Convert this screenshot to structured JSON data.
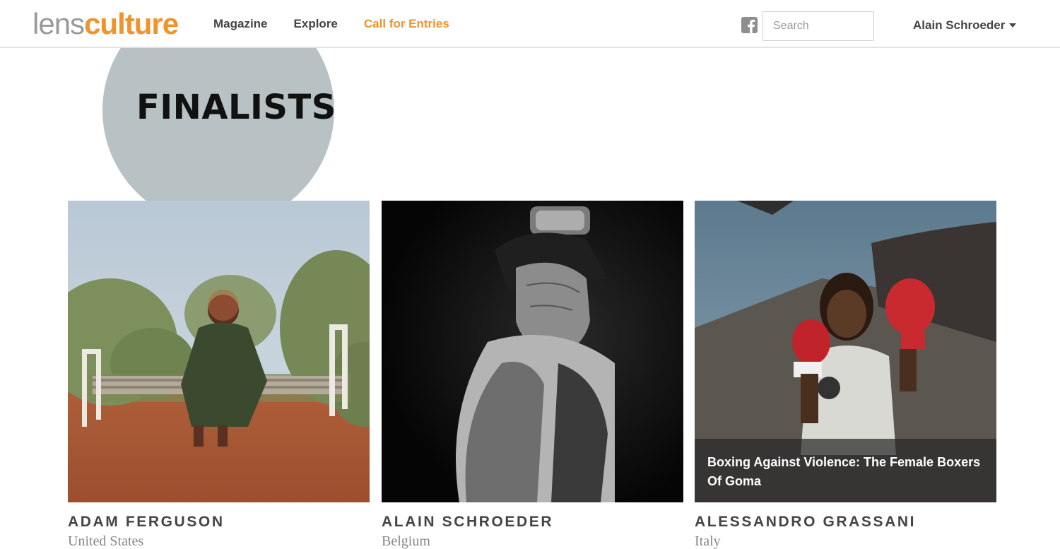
{
  "header": {
    "logo": {
      "part1": "lens",
      "part2": "culture"
    },
    "nav": [
      {
        "label": "Magazine"
      },
      {
        "label": "Explore"
      },
      {
        "label": "Call for Entries"
      }
    ],
    "social_icon": "facebook-icon",
    "search": {
      "placeholder": "Search",
      "value": ""
    },
    "user": {
      "name": "Alain Schroeder",
      "caret_icon": "caret-down-icon"
    }
  },
  "section": {
    "title": "FINALISTS"
  },
  "finalists": [
    {
      "name": "ADAM FERGUSON",
      "country": "United States",
      "caption": ""
    },
    {
      "name": "ALAIN SCHROEDER",
      "country": "Belgium",
      "caption": ""
    },
    {
      "name": "ALESSANDRO GRASSANI",
      "country": "Italy",
      "caption": "Boxing Against Violence: The Female Boxers Of Goma"
    }
  ],
  "colors": {
    "accent": "#f0932b",
    "logo_gray": "#9a9a9a",
    "circle": "#b8c1c4",
    "nav_text": "#444444",
    "country_text": "#888888"
  }
}
